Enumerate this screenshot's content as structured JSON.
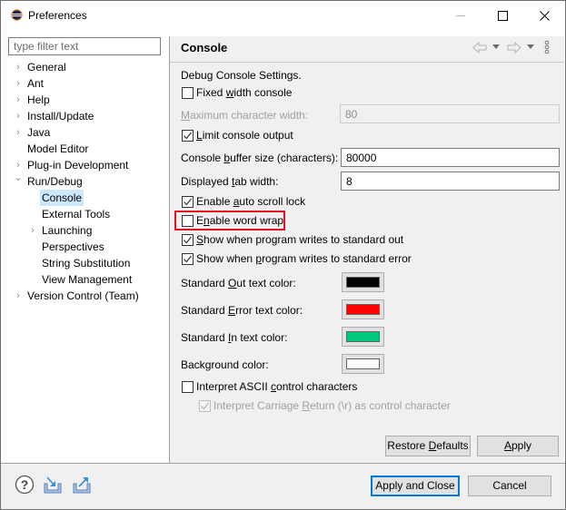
{
  "window": {
    "title": "Preferences",
    "app_icon": "eclipse-icon",
    "controls": [
      "minimize-icon",
      "maximize-icon",
      "close-icon"
    ]
  },
  "filter": {
    "placeholder": "type filter text",
    "value": ""
  },
  "tree": {
    "items": [
      {
        "label": "General",
        "expander": "collapsed",
        "level": 0
      },
      {
        "label": "Ant",
        "expander": "collapsed",
        "level": 0
      },
      {
        "label": "Help",
        "expander": "collapsed",
        "level": 0
      },
      {
        "label": "Install/Update",
        "expander": "collapsed",
        "level": 0
      },
      {
        "label": "Java",
        "expander": "collapsed",
        "level": 0
      },
      {
        "label": "Model Editor",
        "expander": "none",
        "level": 0
      },
      {
        "label": "Plug-in Development",
        "expander": "collapsed",
        "level": 0
      },
      {
        "label": "Run/Debug",
        "expander": "expanded",
        "level": 0
      },
      {
        "label": "Console",
        "expander": "none",
        "level": 1,
        "selected": true
      },
      {
        "label": "External Tools",
        "expander": "none",
        "level": 1
      },
      {
        "label": "Launching",
        "expander": "collapsed",
        "level": 1
      },
      {
        "label": "Perspectives",
        "expander": "none",
        "level": 1
      },
      {
        "label": "String Substitution",
        "expander": "none",
        "level": 1
      },
      {
        "label": "View Management",
        "expander": "none",
        "level": 1
      },
      {
        "label": "Version Control (Team)",
        "expander": "collapsed",
        "level": 0
      }
    ]
  },
  "page": {
    "title": "Console",
    "nav": {
      "back": "back-arrow-icon",
      "forward": "forward-arrow-icon",
      "menu": "view-menu-icon"
    },
    "description": "Debug Console Settings.",
    "fixed_width": {
      "pre": "Fixed ",
      "mn": "w",
      "post": "idth console",
      "checked": false
    },
    "max_char_width": {
      "pre": "",
      "mn": "M",
      "post": "aximum character width:",
      "value": "80",
      "enabled": false
    },
    "limit_output": {
      "pre": "",
      "mn": "L",
      "post": "imit console output",
      "checked": true
    },
    "buffer_size": {
      "pre": "Console ",
      "mn": "b",
      "post": "uffer size (characters):",
      "value": "80000"
    },
    "tab_width": {
      "pre": "Displayed ",
      "mn": "t",
      "post": "ab width:",
      "value": "8"
    },
    "auto_scroll": {
      "pre": "Enable ",
      "mn": "a",
      "post": "uto scroll lock",
      "checked": true
    },
    "word_wrap": {
      "pre": "E",
      "mn": "n",
      "post": "able word wrap",
      "checked": false,
      "highlighted": true,
      "highlight_color": "#e81123"
    },
    "show_stdout": {
      "pre": "",
      "mn": "S",
      "post": "how when program writes to standard out",
      "checked": true
    },
    "show_stderr": {
      "pre": "Show when ",
      "mn": "p",
      "post": "rogram writes to standard error",
      "checked": true
    },
    "colors": [
      {
        "pre": "Standard ",
        "mn": "O",
        "post": "ut text color:",
        "color": "#000000"
      },
      {
        "pre": "Standard ",
        "mn": "E",
        "post": "rror text color:",
        "color": "#ff0000"
      },
      {
        "pre": "Standard ",
        "mn": "I",
        "post": "n text color:",
        "color": "#00c87d"
      },
      {
        "pre": "Back",
        "mn": "g",
        "post": "round color:",
        "color": "#ffffff"
      }
    ],
    "interpret_ascii": {
      "pre": "Interpret ASCII ",
      "mn": "c",
      "post": "ontrol characters",
      "checked": false
    },
    "interpret_cr": {
      "pre": "Interpret Carriage ",
      "mn": "R",
      "post": "eturn (\\r) as control character",
      "checked": true,
      "enabled": false
    },
    "restore_defaults": {
      "pre": "Restore ",
      "mn": "D",
      "post": "efaults"
    },
    "apply": {
      "pre": "",
      "mn": "A",
      "post": "pply"
    }
  },
  "footer": {
    "icons": [
      "help-icon",
      "import-icon",
      "export-icon"
    ],
    "apply_close": "Apply and Close",
    "cancel": "Cancel"
  }
}
